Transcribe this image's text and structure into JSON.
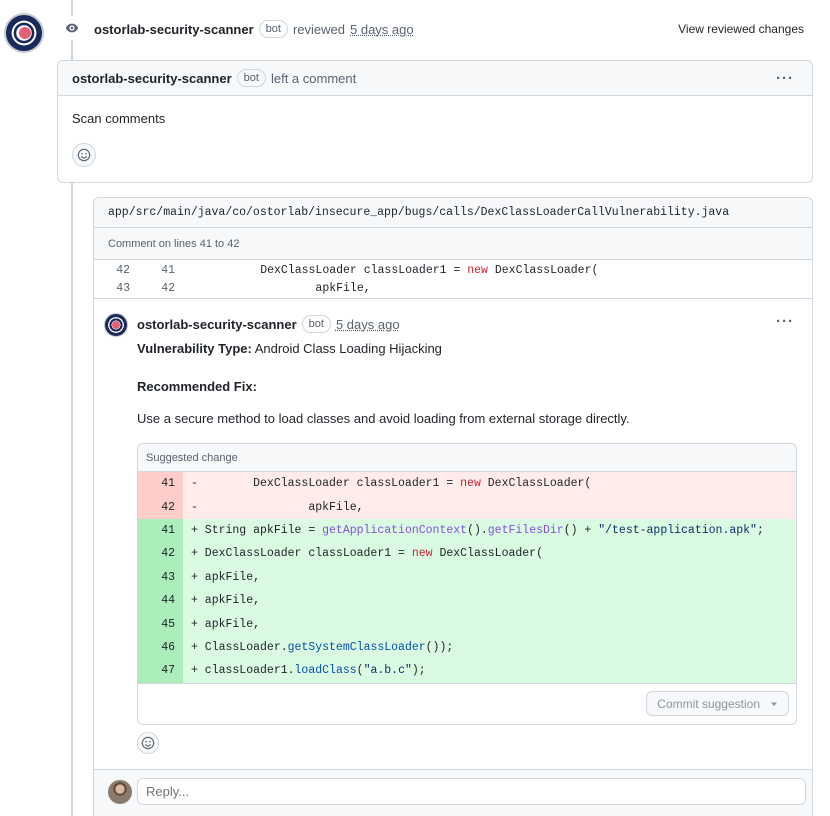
{
  "review": {
    "author": "ostorlab-security-scanner",
    "badge": "bot",
    "action": "reviewed",
    "time": "5 days ago",
    "view_changes": "View reviewed changes"
  },
  "comment": {
    "author": "ostorlab-security-scanner",
    "badge": "bot",
    "action": "left a comment",
    "menu": "···",
    "body": "Scan comments"
  },
  "thread": {
    "file_path": "app/src/main/java/co/ostorlab/insecure_app/bugs/calls/DexClassLoaderCallVulnerability.java",
    "lines_label": "Comment on lines 41 to 42",
    "context": [
      {
        "old": "42",
        "new": "41",
        "pre": "        DexClassLoader classLoader1 = ",
        "kw": "new",
        "post": " DexClassLoader("
      },
      {
        "old": "43",
        "new": "42",
        "pre": "                apkFile,",
        "kw": "",
        "post": ""
      }
    ],
    "review_comment": {
      "author": "ostorlab-security-scanner",
      "badge": "bot",
      "time": "5 days ago",
      "menu": "···",
      "vuln_label": "Vulnerability Type:",
      "vuln_value": " Android Class Loading Hijacking",
      "fix_label": "Recommended Fix:",
      "fix_text": "Use a secure method to load classes and avoid loading from external storage directly.",
      "suggested_label": "Suggested change",
      "commit_label": "Commit suggestion"
    },
    "reply_placeholder": "Reply..."
  },
  "suggestion_lines": [
    {
      "type": "del",
      "num": "41"
    },
    {
      "type": "del",
      "num": "42"
    },
    {
      "type": "add",
      "num": "41"
    },
    {
      "type": "add",
      "num": "42"
    },
    {
      "type": "add",
      "num": "43"
    },
    {
      "type": "add",
      "num": "44"
    },
    {
      "type": "add",
      "num": "45"
    },
    {
      "type": "add",
      "num": "46"
    },
    {
      "type": "add",
      "num": "47"
    }
  ],
  "colors": {
    "deleted_bg": "#ffebe9",
    "added_bg": "#dafbe1",
    "keyword": "#cf222e",
    "method": "#8250df",
    "string": "#0a3069"
  }
}
